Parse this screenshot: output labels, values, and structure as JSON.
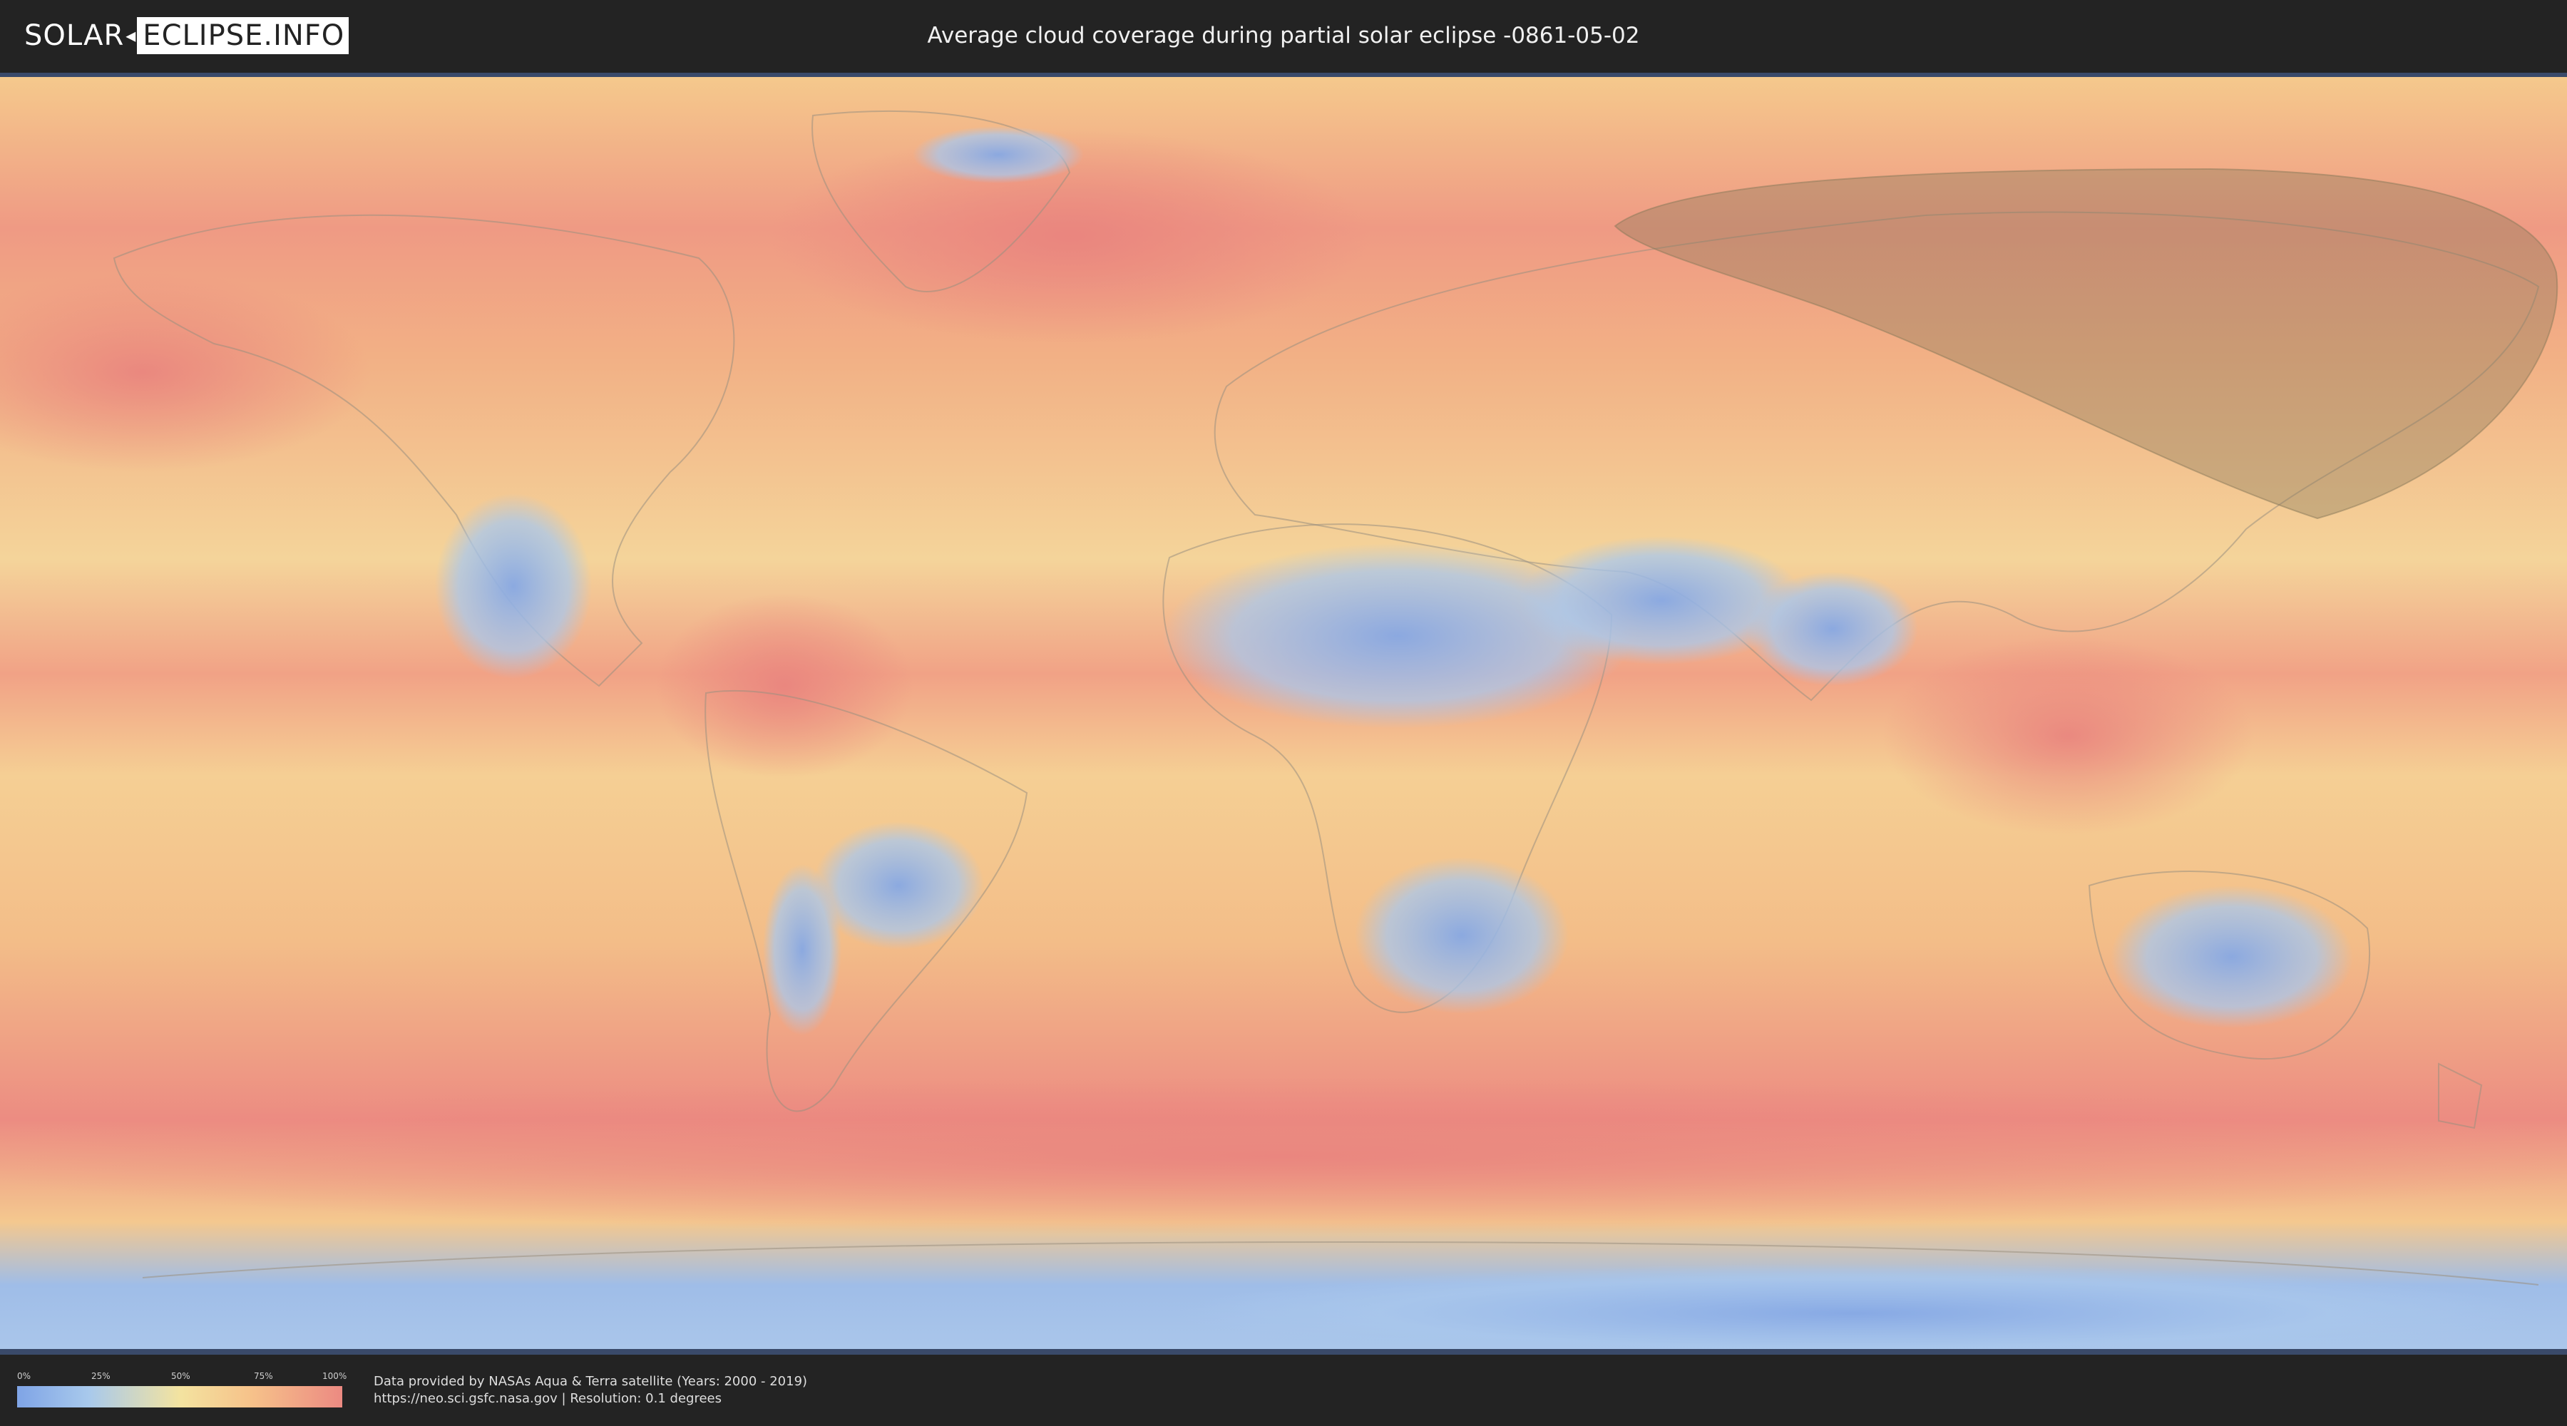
{
  "header": {
    "logo_left": "SOLAR",
    "logo_right": "ECLIPSE.INFO",
    "title": "Average cloud coverage during partial solar eclipse -0861-05-02"
  },
  "map": {
    "description_layer": "world cloud coverage map",
    "colors": {
      "clear": "#7fa4e6",
      "low": "#a8c9ec",
      "mid": "#f3e3a0",
      "high": "#f6c28a",
      "overcast": "#ec8a82",
      "eclipse_shadow": "#8a7a5a",
      "frame": "#3a4a6a"
    }
  },
  "legend": {
    "ticks": [
      "0%",
      "25%",
      "50%",
      "75%",
      "100%"
    ]
  },
  "footer": {
    "credit_line1": "Data provided by NASAs Aqua & Terra satellite (Years: 2000 - 2019)",
    "credit_line2": "https://neo.sci.gsfc.nasa.gov | Resolution: 0.1 degrees"
  }
}
